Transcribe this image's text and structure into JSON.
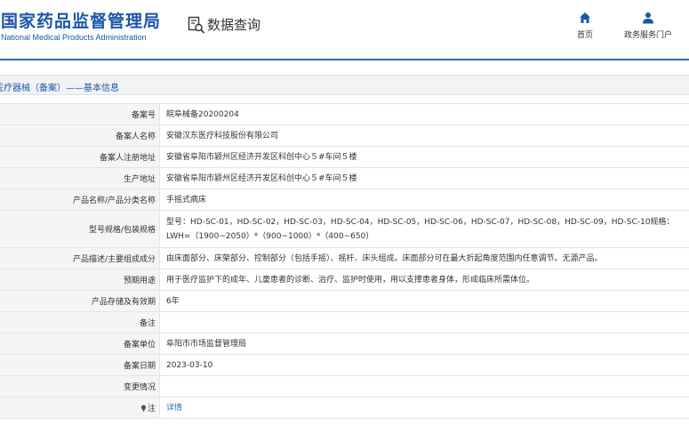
{
  "header": {
    "logo_cn": "国家药品监督管理局",
    "logo_en": "National Medical Products Administration",
    "query_label": "数据查询",
    "nav": [
      {
        "label": "首页",
        "icon": "home-icon"
      },
      {
        "label": "政务服务门户",
        "icon": "user-icon"
      }
    ]
  },
  "section": {
    "title": "医疗器械（备案）——基本信息"
  },
  "rows": [
    {
      "label": "备案号",
      "value": "皖阜械备20200204"
    },
    {
      "label": "备案人名称",
      "value": "安徽汉东医疗科技股份有限公司"
    },
    {
      "label": "备案人注册地址",
      "value": "安徽省阜阳市颍州区经济开发区科创中心５#车间５楼"
    },
    {
      "label": "生产地址",
      "value": "安徽省阜阳市颍州区经济开发区科创中心５#车间５楼"
    },
    {
      "label": "产品名称/产品分类名称",
      "value": "手摇式病床"
    },
    {
      "label": "型号规格/包装规格",
      "value": "型号：HD-SC-01，HD-SC-02，HD-SC-03，HD-SC-04，HD-SC-05，HD-SC-06，HD-SC-07，HD-SC-08，HD-SC-09，HD-SC-10规格：LWH=（1900~2050）*（900~1000）*（400~650）"
    },
    {
      "label": "产品描述/主要组成成分",
      "value": "由床面部分、床架部分、控制部分（包括手摇）、摇杆、床头组成。床面部分可在最大折起角度范围内任意调节。无源产品。"
    },
    {
      "label": "预期用途",
      "value": "用于医疗监护下的成年、儿童患者的诊断、治疗、监护时使用，用以支撑患者身体，形成临床所需体位。"
    },
    {
      "label": "产品存储及有效期",
      "value": "6年"
    },
    {
      "label": "备注",
      "value": ""
    },
    {
      "label": "备案单位",
      "value": "阜阳市市场监督管理局"
    },
    {
      "label": "备案日期",
      "value": "2023-03-10"
    },
    {
      "label": "变更情况",
      "value": ""
    },
    {
      "label": "注",
      "value": "详情"
    }
  ],
  "colors": {
    "brand": "#1a56a6",
    "link": "#2f6db5",
    "label_bg": "#f4f5f7",
    "border": "#e2e5ea"
  }
}
